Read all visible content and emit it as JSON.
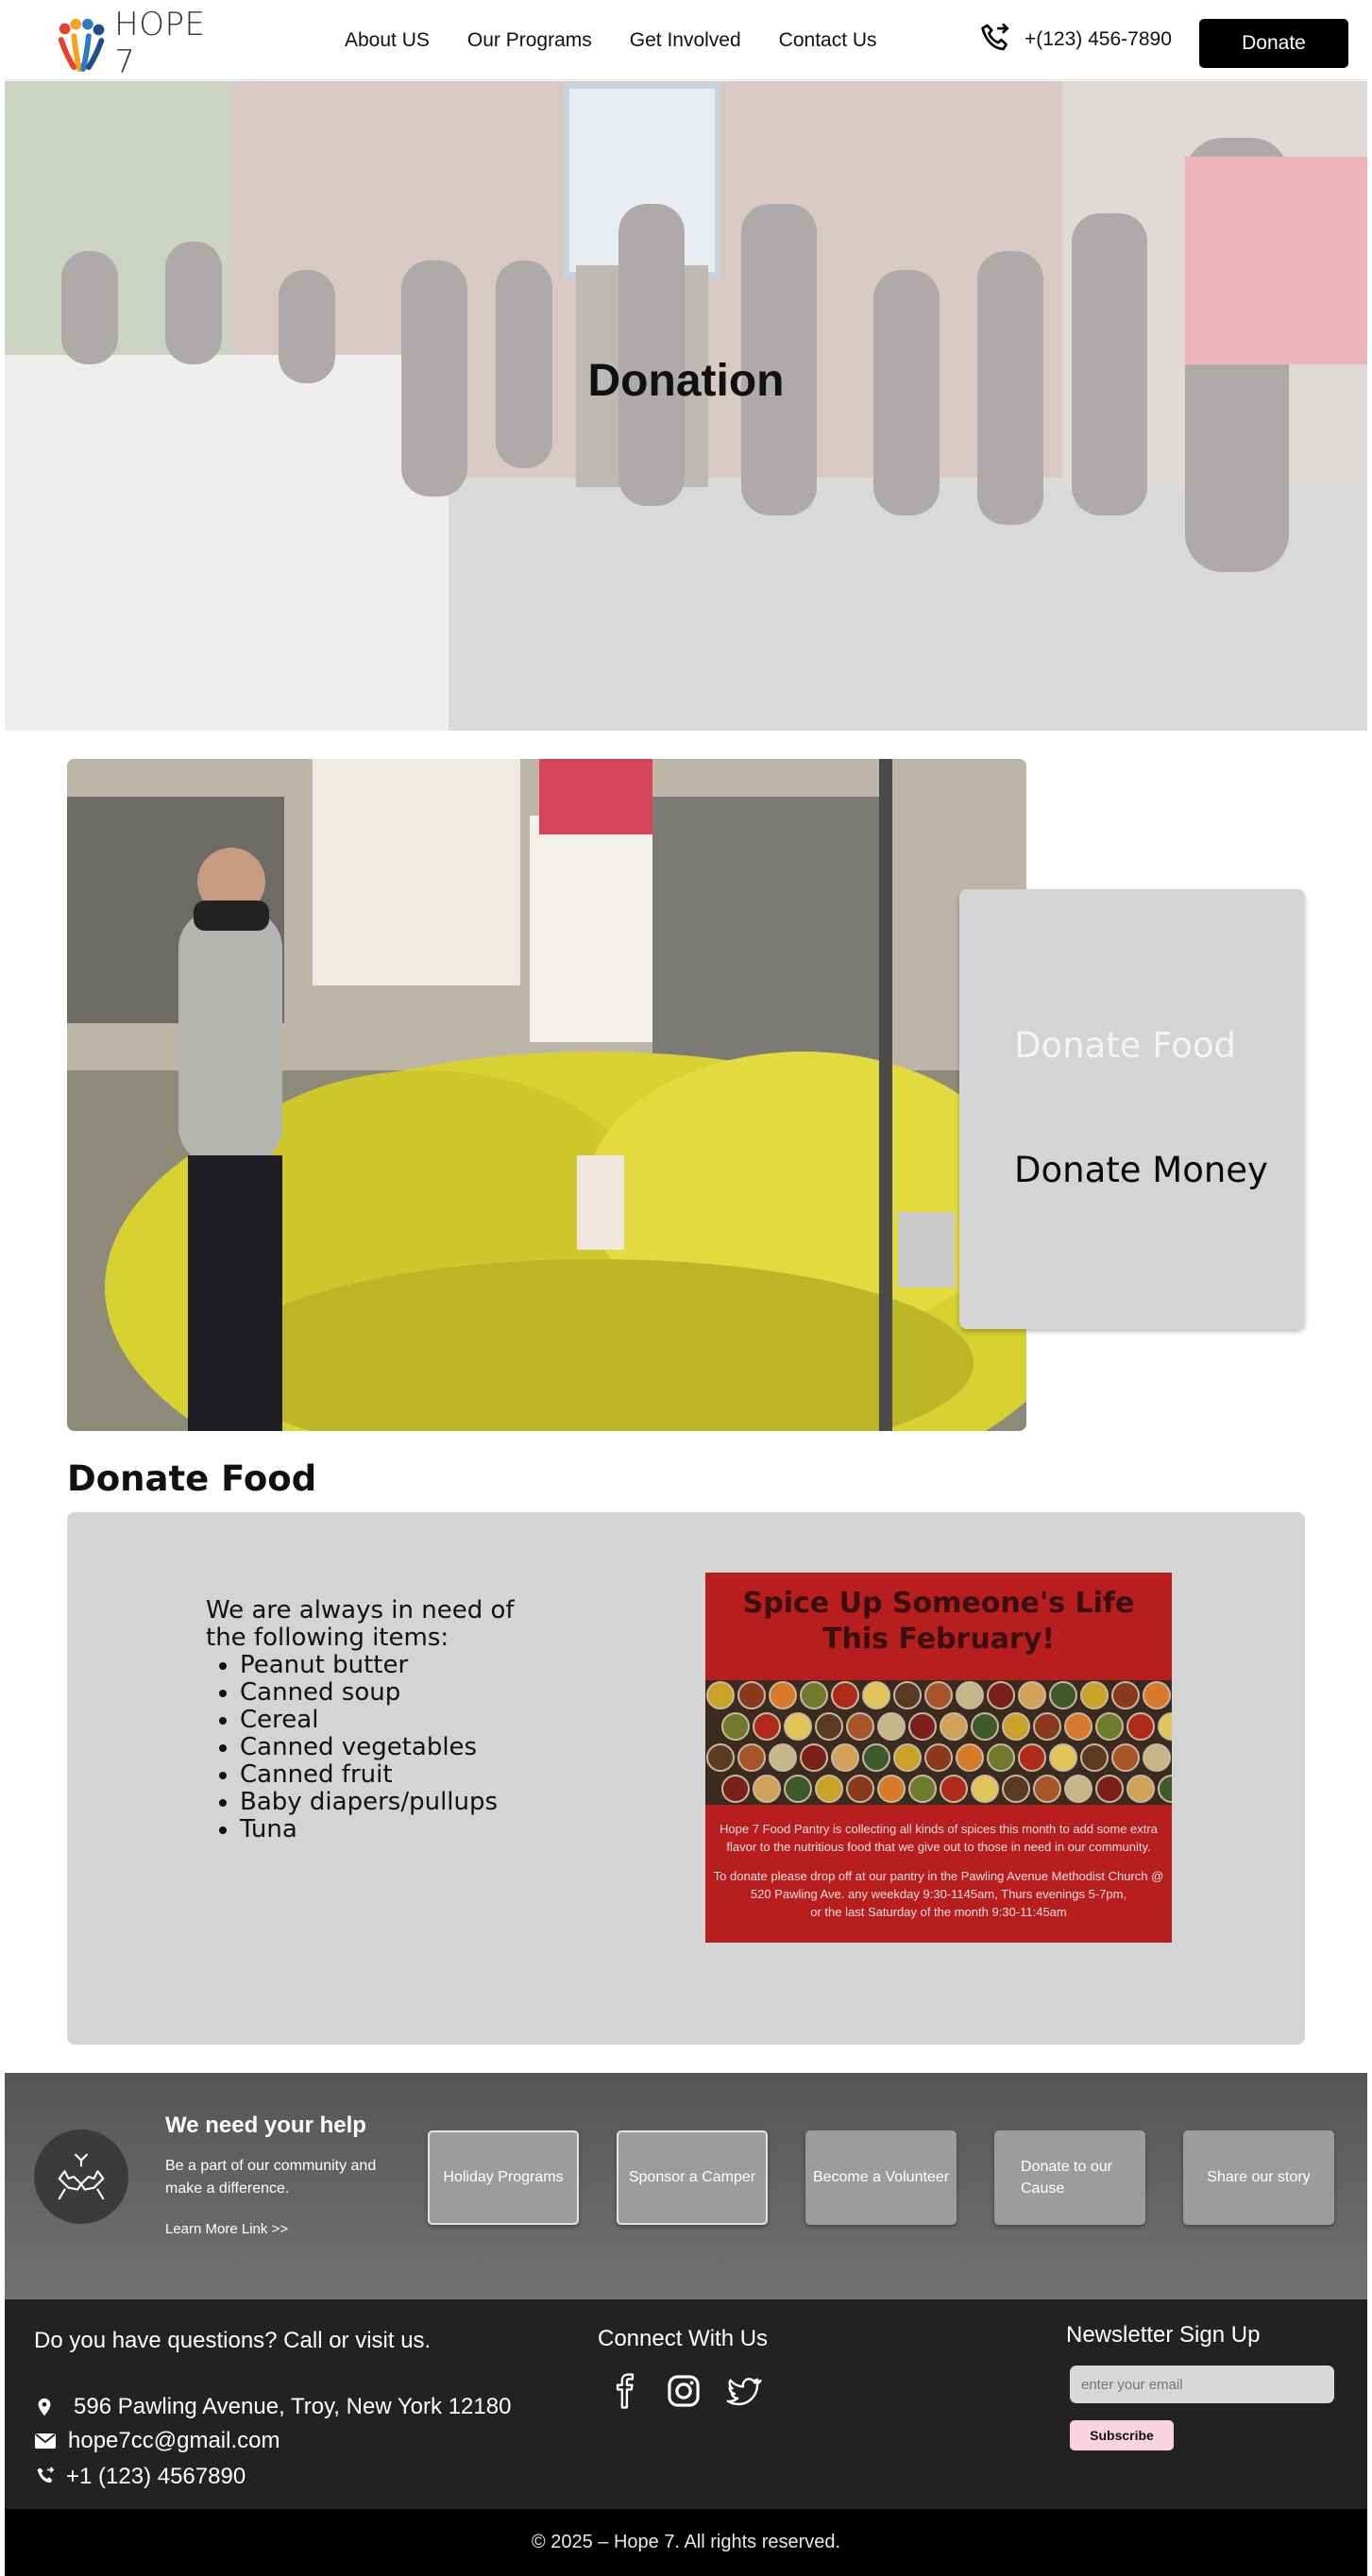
{
  "header": {
    "logo_text": "HOPE 7",
    "nav": [
      "About US",
      "Our Programs",
      "Get Involved",
      "Contact Us"
    ],
    "phone": "+(123) 456-7890",
    "donate_label": "Donate"
  },
  "hero": {
    "title": "Donation"
  },
  "selector": {
    "items": [
      "Donate Food",
      "Donate Money"
    ],
    "active": "Donate Food"
  },
  "donate_food": {
    "title": "Donate Food",
    "intro": "We are always in need of the following items:",
    "items": [
      "Peanut butter",
      "Canned soup",
      "Cereal",
      "Canned vegetables",
      "Canned fruit",
      "Baby diapers/pullups",
      "Tuna"
    ]
  },
  "flyer": {
    "headline": "Spice Up Someone's Life This February!",
    "body_1": "Hope 7 Food Pantry is collecting all kinds of spices this month to add some extra flavor to the nutritious food that we give out to those in need in our community.",
    "body_2": "To donate please drop off at our pantry in the Pawling Avenue Methodist Church @ 520 Pawling Ave. any weekday 9:30-1145am, Thurs evenings 5-7pm,",
    "body_3": "or the last Saturday of the month 9:30-11:45am"
  },
  "help": {
    "title": "We need your help",
    "text": "Be a part of our community and make a difference.",
    "link": "Learn More Link >>",
    "buttons": [
      "Holiday Programs",
      "Sponsor a Camper",
      "Become a Volunteer",
      "Donate to our Cause",
      "Share our story"
    ]
  },
  "footer": {
    "question": "Do you have questions? Call or visit us.",
    "address": "596 Pawling Avenue, Troy, New York 12180",
    "email": "hope7cc@gmail.com",
    "phone": "+1 (123) 4567890",
    "connect_title": "Connect With Us",
    "social": [
      "facebook-icon",
      "instagram-icon",
      "twitter-icon"
    ],
    "newsletter_title": "Newsletter Sign Up",
    "email_placeholder": "enter your email",
    "subscribe_label": "Subscribe",
    "copyright": "© 2025 – Hope 7. All rights reserved."
  },
  "colors": {
    "accent": "#000000",
    "footer_bg": "#222222",
    "panel_bg": "#d4d4d4",
    "flyer_red": "#b81e1e",
    "subscribe_bg": "#f9d3df"
  }
}
